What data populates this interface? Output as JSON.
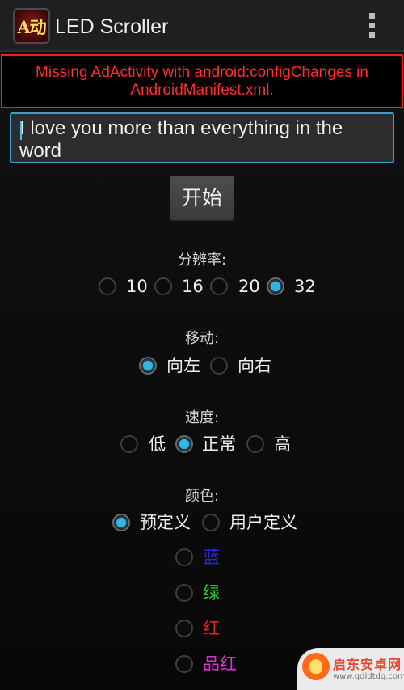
{
  "action_bar": {
    "title": "LED Scroller",
    "icon": "app-icon-ab-glyph",
    "icon_glyph": "A动"
  },
  "ad_error": {
    "message": "Missing AdActivity with android:configChanges in AndroidManifest.xml.",
    "color": "#ff2d2d"
  },
  "message_input": {
    "value": "I love you  more than everything in the word"
  },
  "start_button": {
    "label": "开始"
  },
  "resolution": {
    "label": "分辨率:",
    "options": [
      "10",
      "16",
      "20",
      "32"
    ],
    "selected": "32"
  },
  "direction": {
    "label": "移动:",
    "options": [
      "向左",
      "向右"
    ],
    "selected": "向左"
  },
  "speed": {
    "label": "速度:",
    "options": [
      "低",
      "正常",
      "高"
    ],
    "selected": "正常"
  },
  "color": {
    "label": "颜色:",
    "modes": [
      "预定义",
      "用户定义"
    ],
    "selected_mode": "预定义",
    "presets": [
      {
        "label": "蓝",
        "hex": "#2a2ad8"
      },
      {
        "label": "绿",
        "hex": "#27d43a"
      },
      {
        "label": "红",
        "hex": "#e02424"
      },
      {
        "label": "品红",
        "hex": "#e02ee0"
      }
    ]
  },
  "accent_color": "#33b5e5",
  "watermark": {
    "text": "启东安卓网",
    "url": "www.qdldtdq.com"
  }
}
